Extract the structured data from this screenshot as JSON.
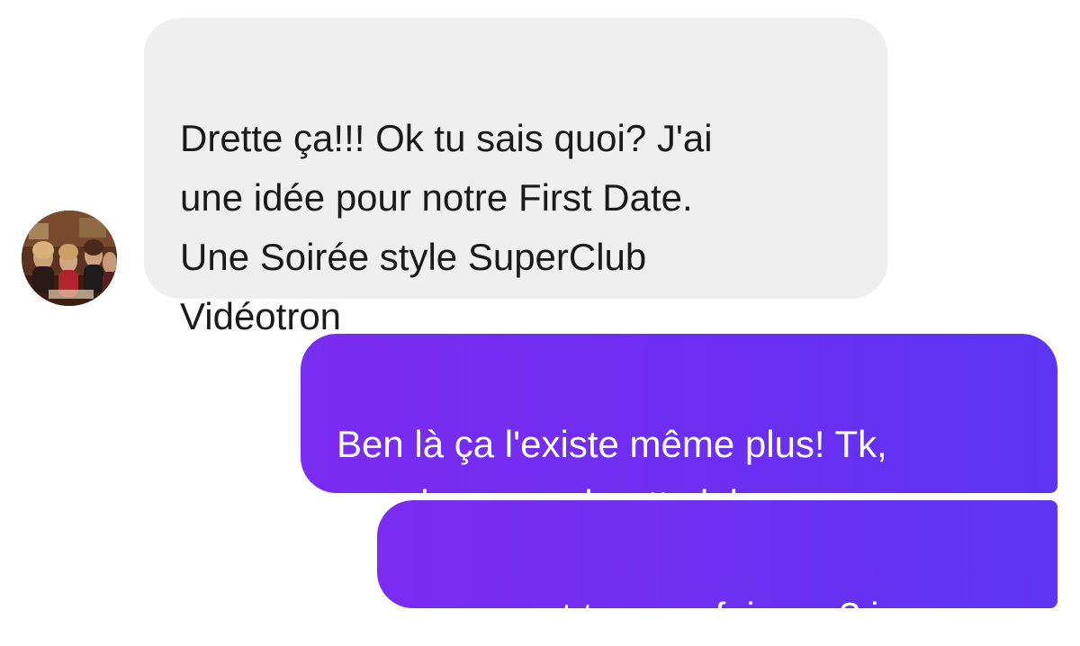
{
  "conversation": {
    "messages": [
      {
        "direction": "incoming",
        "text": "Drette ça!!! Ok tu sais quoi? J'ai\nune idée pour notre First Date.\nUne Soirée style SuperClub\nVidéotron"
      },
      {
        "direction": "outgoing",
        "text": "Ben là ça l'existe même plus! Tk,\npas dans mon boutte lol"
      },
      {
        "direction": "outgoing",
        "text": "comment tu veux faire ça? je"
      }
    ],
    "colors": {
      "incoming_bubble": "#efefef",
      "incoming_text": "#1a1a1a",
      "outgoing_bubble": "#6b2ff1",
      "outgoing_text": "#ffffff",
      "background": "#ffffff"
    }
  }
}
